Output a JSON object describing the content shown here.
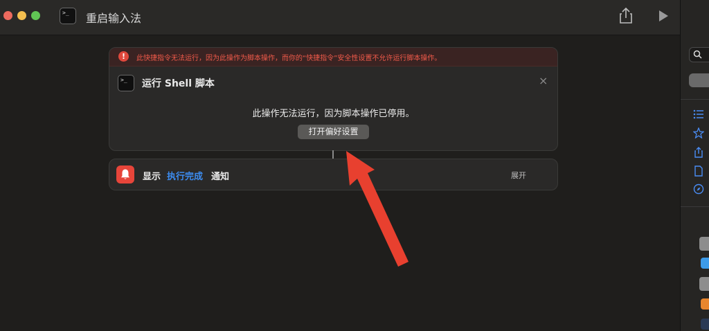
{
  "window": {
    "title": "重启输入法"
  },
  "action": {
    "error_banner": "此快捷指令无法运行，因为此操作为脚本操作，而你的“快捷指令”安全性设置不允许运行脚本操作。",
    "title": "运行 Shell 脚本",
    "message": "此操作无法运行，因为脚本操作已停用。",
    "button_label": "打开偏好设置"
  },
  "notification": {
    "show_label": "显示",
    "variable_label": "执行完成",
    "notify_label": "通知",
    "expand_label": "展开"
  },
  "icons": {
    "close": "×",
    "error": "!",
    "prompt": ">_"
  },
  "colors": {
    "accent_blue": "#3c8cf0",
    "error_red": "#e0483c",
    "arrow_red": "#e8402f"
  }
}
